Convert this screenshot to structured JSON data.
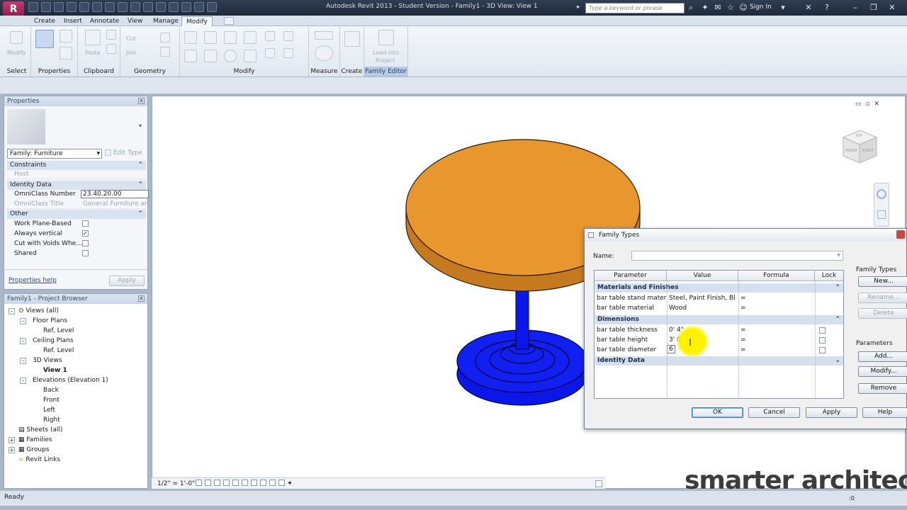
{
  "app": {
    "menu_letter": "R",
    "title": "Autodesk Revit 2013 - Student Version -     Family1 - 3D View: View 1",
    "search_placeholder": "Type a keyword or phrase",
    "sign_in": "Sign In"
  },
  "tabs": [
    "Create",
    "Insert",
    "Annotate",
    "View",
    "Manage",
    "Modify"
  ],
  "ribbon": {
    "panels": [
      "Select",
      "Properties",
      "Clipboard",
      "Geometry",
      "Modify",
      "Measure",
      "Create",
      "Family Editor"
    ],
    "modify_label": "Modify",
    "paste_label": "Paste",
    "cut_label": "Cut",
    "join_label": "Join",
    "load_into_label": "Load into",
    "project_label": "Project"
  },
  "properties": {
    "title": "Properties",
    "family_selector": "Family: Furniture",
    "edit_type": "Edit Type",
    "groups": {
      "constraints": "Constraints",
      "identity": "Identity Data",
      "other": "Other"
    },
    "rows": {
      "host": "Host",
      "omniclass_number": "OmniClass Number",
      "omniclass_number_value": "23.40.20.00",
      "omniclass_title": "OmniClass Title",
      "omniclass_title_value": "General Furniture an...",
      "work_plane": "Work Plane-Based",
      "always_vertical": "Always vertical",
      "cut_voids": "Cut with Voids Whe...",
      "shared": "Shared"
    },
    "help_link": "Properties help",
    "apply": "Apply"
  },
  "browser": {
    "title": "Family1 - Project Browser",
    "items": {
      "views": "Views (all)",
      "floor_plans": "Floor Plans",
      "ref_level_1": "Ref. Level",
      "ceiling_plans": "Ceiling Plans",
      "ref_level_2": "Ref. Level",
      "views_3d": "3D Views",
      "view1": "View 1",
      "elevations": "Elevations (Elevation 1)",
      "back": "Back",
      "front": "Front",
      "left": "Left",
      "right": "Right",
      "sheets": "Sheets (all)",
      "families": "Families",
      "groups": "Groups",
      "links": "Revit Links"
    }
  },
  "viewport": {
    "scale": "1/2\" = 1'-0\"",
    "viewcube_top": "TOP",
    "viewcube_front": "FRONT",
    "viewcube_right": "RIGHT",
    "colors": {
      "table_top": "#e8962e",
      "stand": "#0a17e8"
    }
  },
  "family_types": {
    "title": "Family Types",
    "name_label": "Name:",
    "headers": [
      "Parameter",
      "Value",
      "Formula",
      "Lock"
    ],
    "sections": {
      "materials": "Materials and Finishes",
      "dimensions": "Dimensions",
      "identity": "Identity Data"
    },
    "materials": [
      {
        "param": "bar table stand material",
        "value": "Steel, Paint Finish, Bl",
        "formula": "="
      },
      {
        "param": "bar table material",
        "value": "Wood",
        "formula": "="
      }
    ],
    "dimensions": [
      {
        "param": "bar table thickness",
        "value": "0'  4\"",
        "formula": "="
      },
      {
        "param": "bar table height",
        "value": "3'  0\"",
        "formula": "="
      },
      {
        "param": "bar table diameter",
        "value": "6",
        "formula": "="
      }
    ],
    "side": {
      "family_types_label": "Family Types",
      "new": "New...",
      "rename": "Rename...",
      "delete": "Delete",
      "parameters_label": "Parameters",
      "add": "Add...",
      "modify": "Modify...",
      "remove": "Remove"
    },
    "buttons": {
      "ok": "OK",
      "cancel": "Cancel",
      "apply": "Apply",
      "help": "Help"
    }
  },
  "status": {
    "ready": "Ready",
    "zero": ":0"
  },
  "watermark": "smarter architect"
}
